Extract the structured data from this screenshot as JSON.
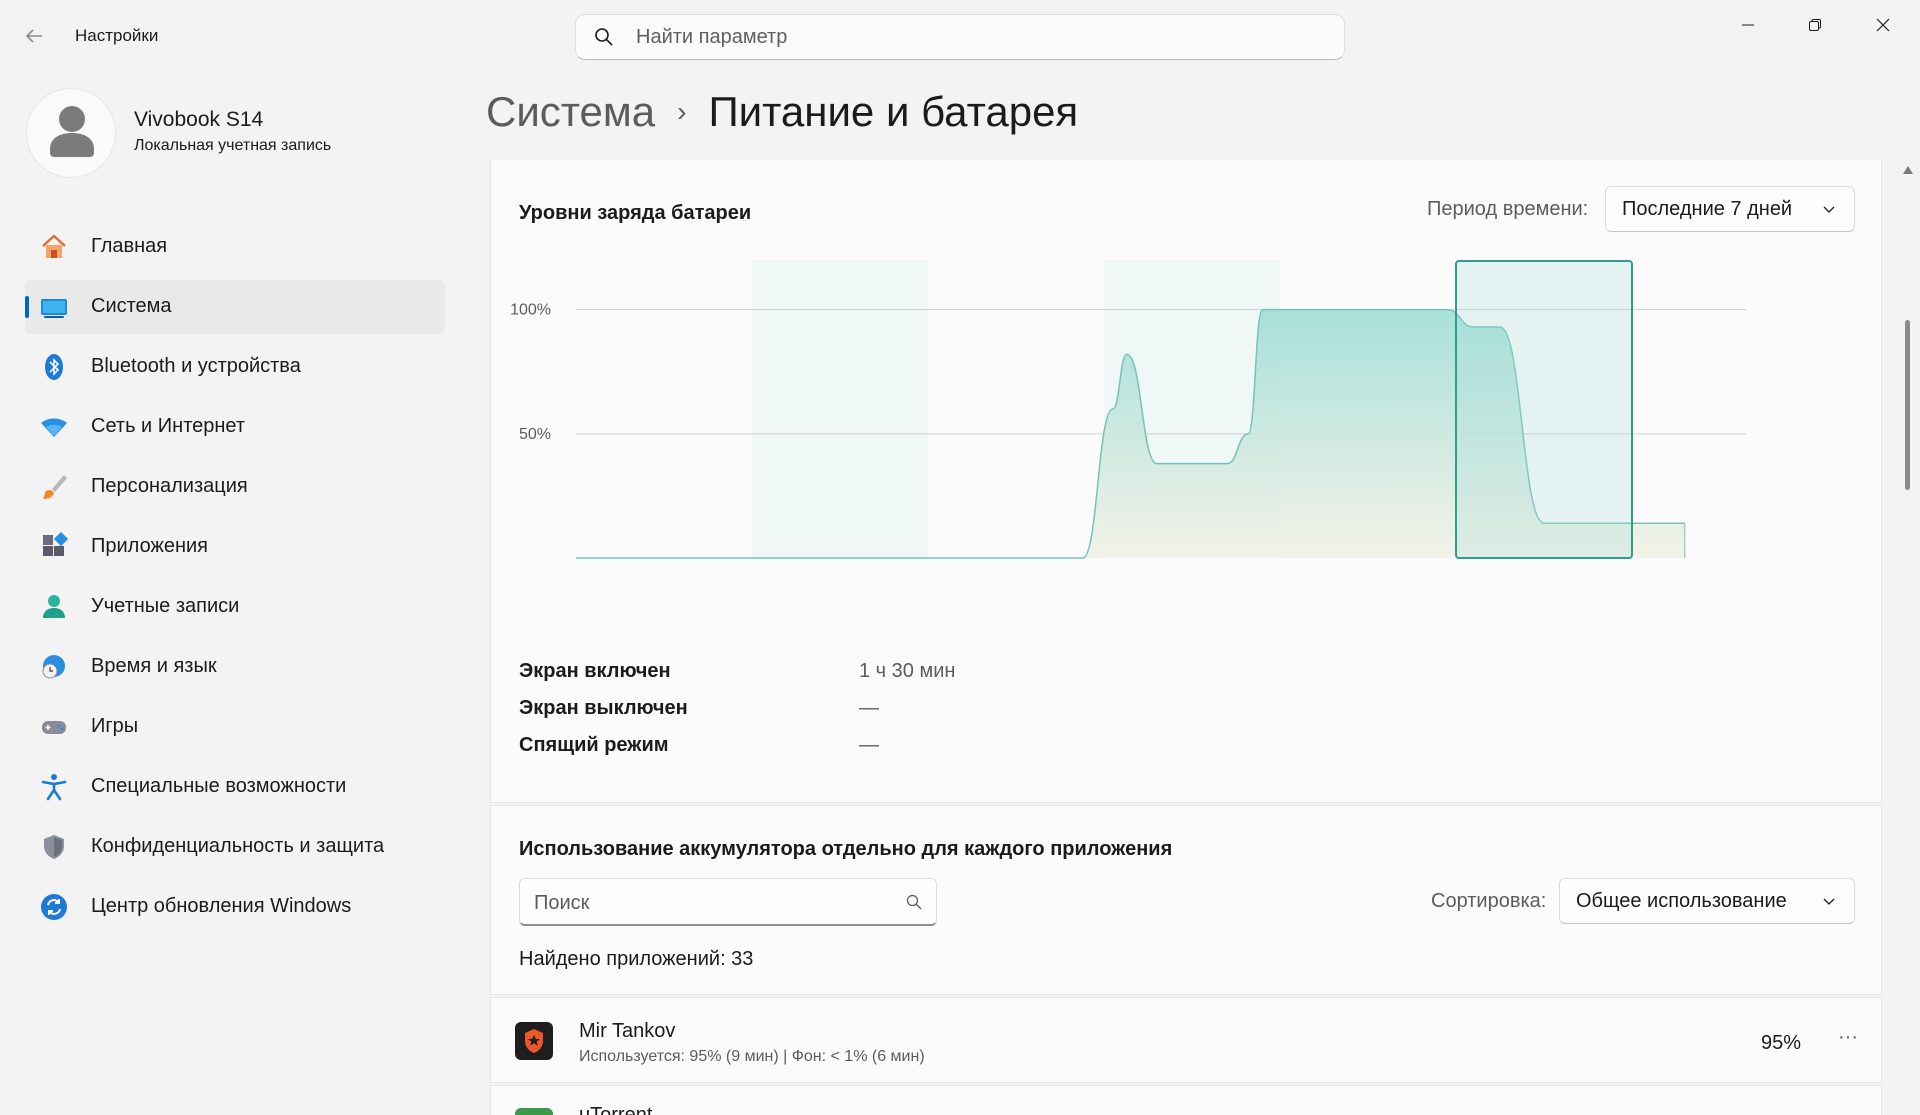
{
  "window": {
    "app_title": "Настройки",
    "search_placeholder": "Найти параметр"
  },
  "profile": {
    "name": "Vivobook S14",
    "account_type": "Локальная учетная запись"
  },
  "sidebar": {
    "items": [
      {
        "label": "Главная",
        "icon": "home-icon",
        "active": false
      },
      {
        "label": "Система",
        "icon": "system-icon",
        "active": true
      },
      {
        "label": "Bluetooth и устройства",
        "icon": "bluetooth-icon",
        "active": false
      },
      {
        "label": "Сеть и Интернет",
        "icon": "wifi-icon",
        "active": false
      },
      {
        "label": "Персонализация",
        "icon": "brush-icon",
        "active": false
      },
      {
        "label": "Приложения",
        "icon": "apps-icon",
        "active": false
      },
      {
        "label": "Учетные записи",
        "icon": "accounts-icon",
        "active": false
      },
      {
        "label": "Время и язык",
        "icon": "globe-clock-icon",
        "active": false
      },
      {
        "label": "Игры",
        "icon": "gamepad-icon",
        "active": false
      },
      {
        "label": "Специальные возможности",
        "icon": "accessibility-icon",
        "active": false
      },
      {
        "label": "Конфиденциальность и защита",
        "icon": "shield-icon",
        "active": false
      },
      {
        "label": "Центр обновления Windows",
        "icon": "update-icon",
        "active": false
      }
    ]
  },
  "header": {
    "parent": "Система",
    "separator": "›",
    "current": "Питание и батарея"
  },
  "battery_levels": {
    "title": "Уровни заряда батареи",
    "period_label": "Период времени:",
    "period_value": "Последние 7 дней"
  },
  "chart_data": {
    "type": "area",
    "title": "Уровни заряда батареи",
    "ylabel": "",
    "xlabel": "",
    "y_ticks": [
      "100%",
      "50%"
    ],
    "ylim": [
      0,
      120
    ],
    "days": 7,
    "shaded_days": [
      1,
      3
    ],
    "selected_day": 5,
    "grid": true,
    "series": [
      {
        "x": [
          0,
          2.0,
          2.88,
          3.05,
          3.13,
          3.3,
          3.7,
          3.82,
          3.9,
          4.2,
          4.95,
          5.1,
          5.25,
          5.5,
          5.72,
          5.9,
          6.3
        ],
        "y": [
          0,
          0,
          0,
          60,
          82,
          38,
          38,
          50,
          100,
          100,
          100,
          93,
          93,
          14,
          14,
          14,
          14
        ]
      }
    ],
    "colors": {
      "fill_top": "#9fded6",
      "fill_bottom": "#f3f1e6",
      "line": "#74c3b6",
      "selection": "#2e9e92"
    }
  },
  "stats": [
    {
      "label": "Экран включен",
      "value": "1 ч 30 мин"
    },
    {
      "label": "Экран выключен",
      "value": "—"
    },
    {
      "label": "Спящий режим",
      "value": "—"
    }
  ],
  "app_usage": {
    "title": "Использование аккумулятора отдельно для каждого приложения",
    "search_placeholder": "Поиск",
    "sort_label": "Сортировка:",
    "sort_value": "Общее использование",
    "found": "Найдено приложений: 33",
    "apps": [
      {
        "name": "Mir Tankov",
        "usage": "Используется: 95% (9 мин) | Фон: < 1% (6 мин)",
        "percent": "95%",
        "more": "···"
      },
      {
        "name": "uTorrent",
        "usage": "",
        "percent": "",
        "more": ""
      }
    ]
  }
}
